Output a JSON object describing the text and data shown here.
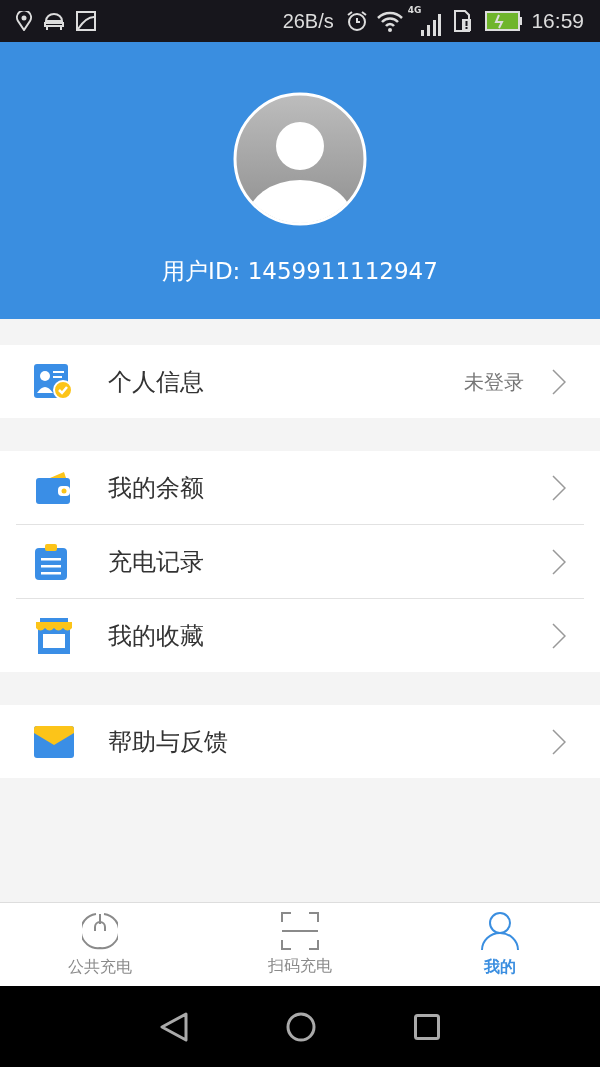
{
  "status_bar": {
    "speed": "26B/s",
    "network": "4G",
    "time": "16:59"
  },
  "profile": {
    "user_id": "用户ID: 1459911112947"
  },
  "menu_groups": [
    [
      {
        "kind": "profile",
        "label": "个人信息",
        "value": "未登录"
      }
    ],
    [
      {
        "kind": "wallet",
        "label": "我的余额"
      },
      {
        "kind": "record",
        "label": "充电记录"
      },
      {
        "kind": "store",
        "label": "我的收藏"
      }
    ],
    [
      {
        "kind": "mail",
        "label": "帮助与反馈"
      }
    ]
  ],
  "tabs": [
    {
      "kind": "pin",
      "label": "公共充电",
      "selected": false
    },
    {
      "kind": "scan",
      "label": "扫码充电",
      "selected": false
    },
    {
      "kind": "person",
      "label": "我的",
      "selected": true
    }
  ]
}
